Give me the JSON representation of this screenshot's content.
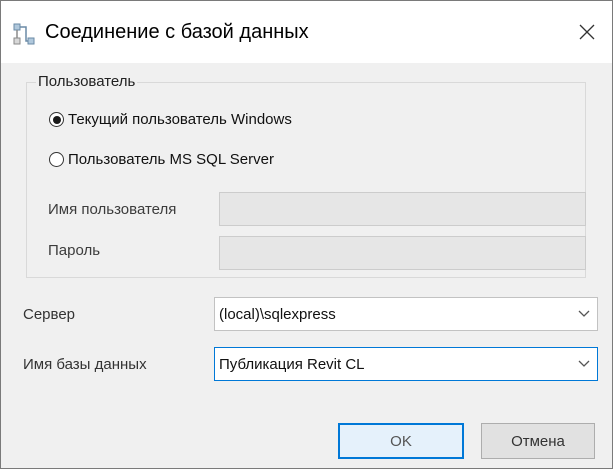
{
  "dialog": {
    "title": "Соединение с базой данных",
    "icon": "database-connection-icon",
    "close_icon": "close-icon"
  },
  "user_group": {
    "legend": "Пользователь",
    "options": [
      {
        "label": "Текущий пользователь Windows",
        "selected": true
      },
      {
        "label": "Пользователь MS SQL Server",
        "selected": false
      }
    ],
    "username_label": "Имя пользователя",
    "username_value": "",
    "password_label": "Пароль",
    "password_value": ""
  },
  "server": {
    "label": "Сервер",
    "value": "(local)\\sqlexpress"
  },
  "database": {
    "label": "Имя базы данных",
    "value": "Публикация Revit CL"
  },
  "buttons": {
    "ok": "OK",
    "cancel": "Отмена"
  },
  "colors": {
    "focus_border": "#0078d7",
    "window_bg": "#f0f0f0",
    "titlebar_bg": "#ffffff"
  }
}
